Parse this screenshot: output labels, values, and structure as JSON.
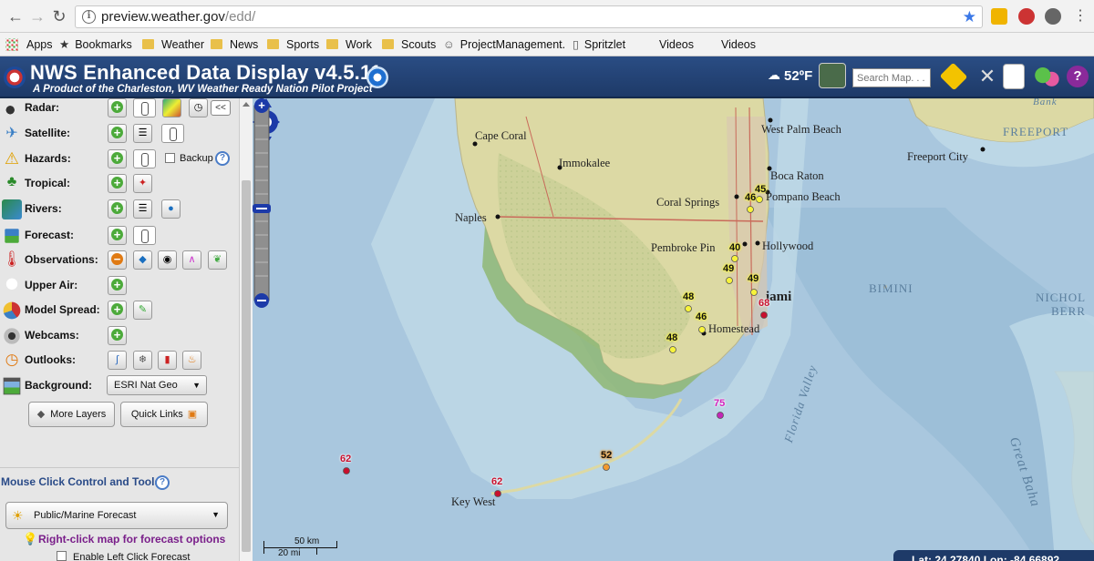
{
  "browser": {
    "url_host": "preview.weather.gov",
    "url_path": "/edd/"
  },
  "bookmarks": {
    "apps": "Apps",
    "bookmarks": "Bookmarks",
    "weather": "Weather",
    "news": "News",
    "sports": "Sports",
    "work": "Work",
    "scouts": "Scouts",
    "pm": "ProjectManagement.",
    "spritzlet": "Spritzlet",
    "videos1": "Videos",
    "videos2": "Videos"
  },
  "header": {
    "title": "NWS Enhanced Data Display v4.5.11",
    "subtitle": "A Product of the Charleston, WV Weather Ready Nation Pilot Project",
    "temperature": "52ºF",
    "search_placeholder": "Search Map. . ."
  },
  "panel": {
    "layers": {
      "radar": "Radar:",
      "satellite": "Satellite:",
      "hazards": "Hazards:",
      "backup": "Backup",
      "tropical": "Tropical:",
      "rivers": "Rivers:",
      "forecast": "Forecast:",
      "observations": "Observations:",
      "upper_air": "Upper Air:",
      "model_spread": "Model Spread:",
      "webcams": "Webcams:",
      "outlooks": "Outlooks:",
      "background": "Background:"
    },
    "radar_collapse": "<<",
    "background_value": "ESRI Nat Geo",
    "more_layers": "More Layers",
    "quick_links": "Quick Links",
    "mouse_click_title": "Mouse Click Control and Tools",
    "forecast_select": "Public/Marine Forecast",
    "rightclick_tip": "Right-click map for forecast options",
    "enable_left_click": "Enable Left Click Forecast"
  },
  "map": {
    "cities": {
      "west_palm": "West Palm Beach",
      "cape_coral": "Cape Coral",
      "immokalee": "Immokalee",
      "boca": "Boca Raton",
      "coral_springs": "Coral Springs",
      "pompano": "Pompano Beach",
      "naples": "Naples",
      "pembroke": "Pembroke Pin",
      "hollywood": "Hollywood",
      "miami": "iami",
      "homestead": "Homestead",
      "key_west": "Key West",
      "freeport_city": "Freeport City",
      "freeport": "FREEPORT",
      "bimini": "BIMINI",
      "nichol": "NICHOL",
      "berr": "BERR",
      "bank": "Bank"
    },
    "features": {
      "florida_valley": "Florida Valley",
      "great_bahama": "Great Baha"
    },
    "observations": [
      {
        "label": "45",
        "style": "yellow"
      },
      {
        "label": "46",
        "style": "yellow"
      },
      {
        "label": "40",
        "style": "yellow"
      },
      {
        "label": "49",
        "style": "yellow"
      },
      {
        "label": "49",
        "style": "yellow"
      },
      {
        "label": "68",
        "style": "red"
      },
      {
        "label": "48",
        "style": "yellow"
      },
      {
        "label": "46",
        "style": "yellow"
      },
      {
        "label": "48",
        "style": "yellow"
      },
      {
        "label": "75",
        "style": "magenta"
      },
      {
        "label": "52",
        "style": "orange"
      },
      {
        "label": "62",
        "style": "red"
      },
      {
        "label": "62",
        "style": "red"
      }
    ],
    "scale_km": "50 km",
    "scale_mi": "20 mi",
    "coords": "Lat: 24.27840  Lon: -84.66892"
  },
  "colors": {
    "header_bg": "#1e3a68",
    "land": "#dcd9a4",
    "water": "#a9c7de",
    "obs_yellow": "#f7f33b",
    "obs_red": "#c8102e",
    "obs_magenta": "#d31fbd"
  }
}
